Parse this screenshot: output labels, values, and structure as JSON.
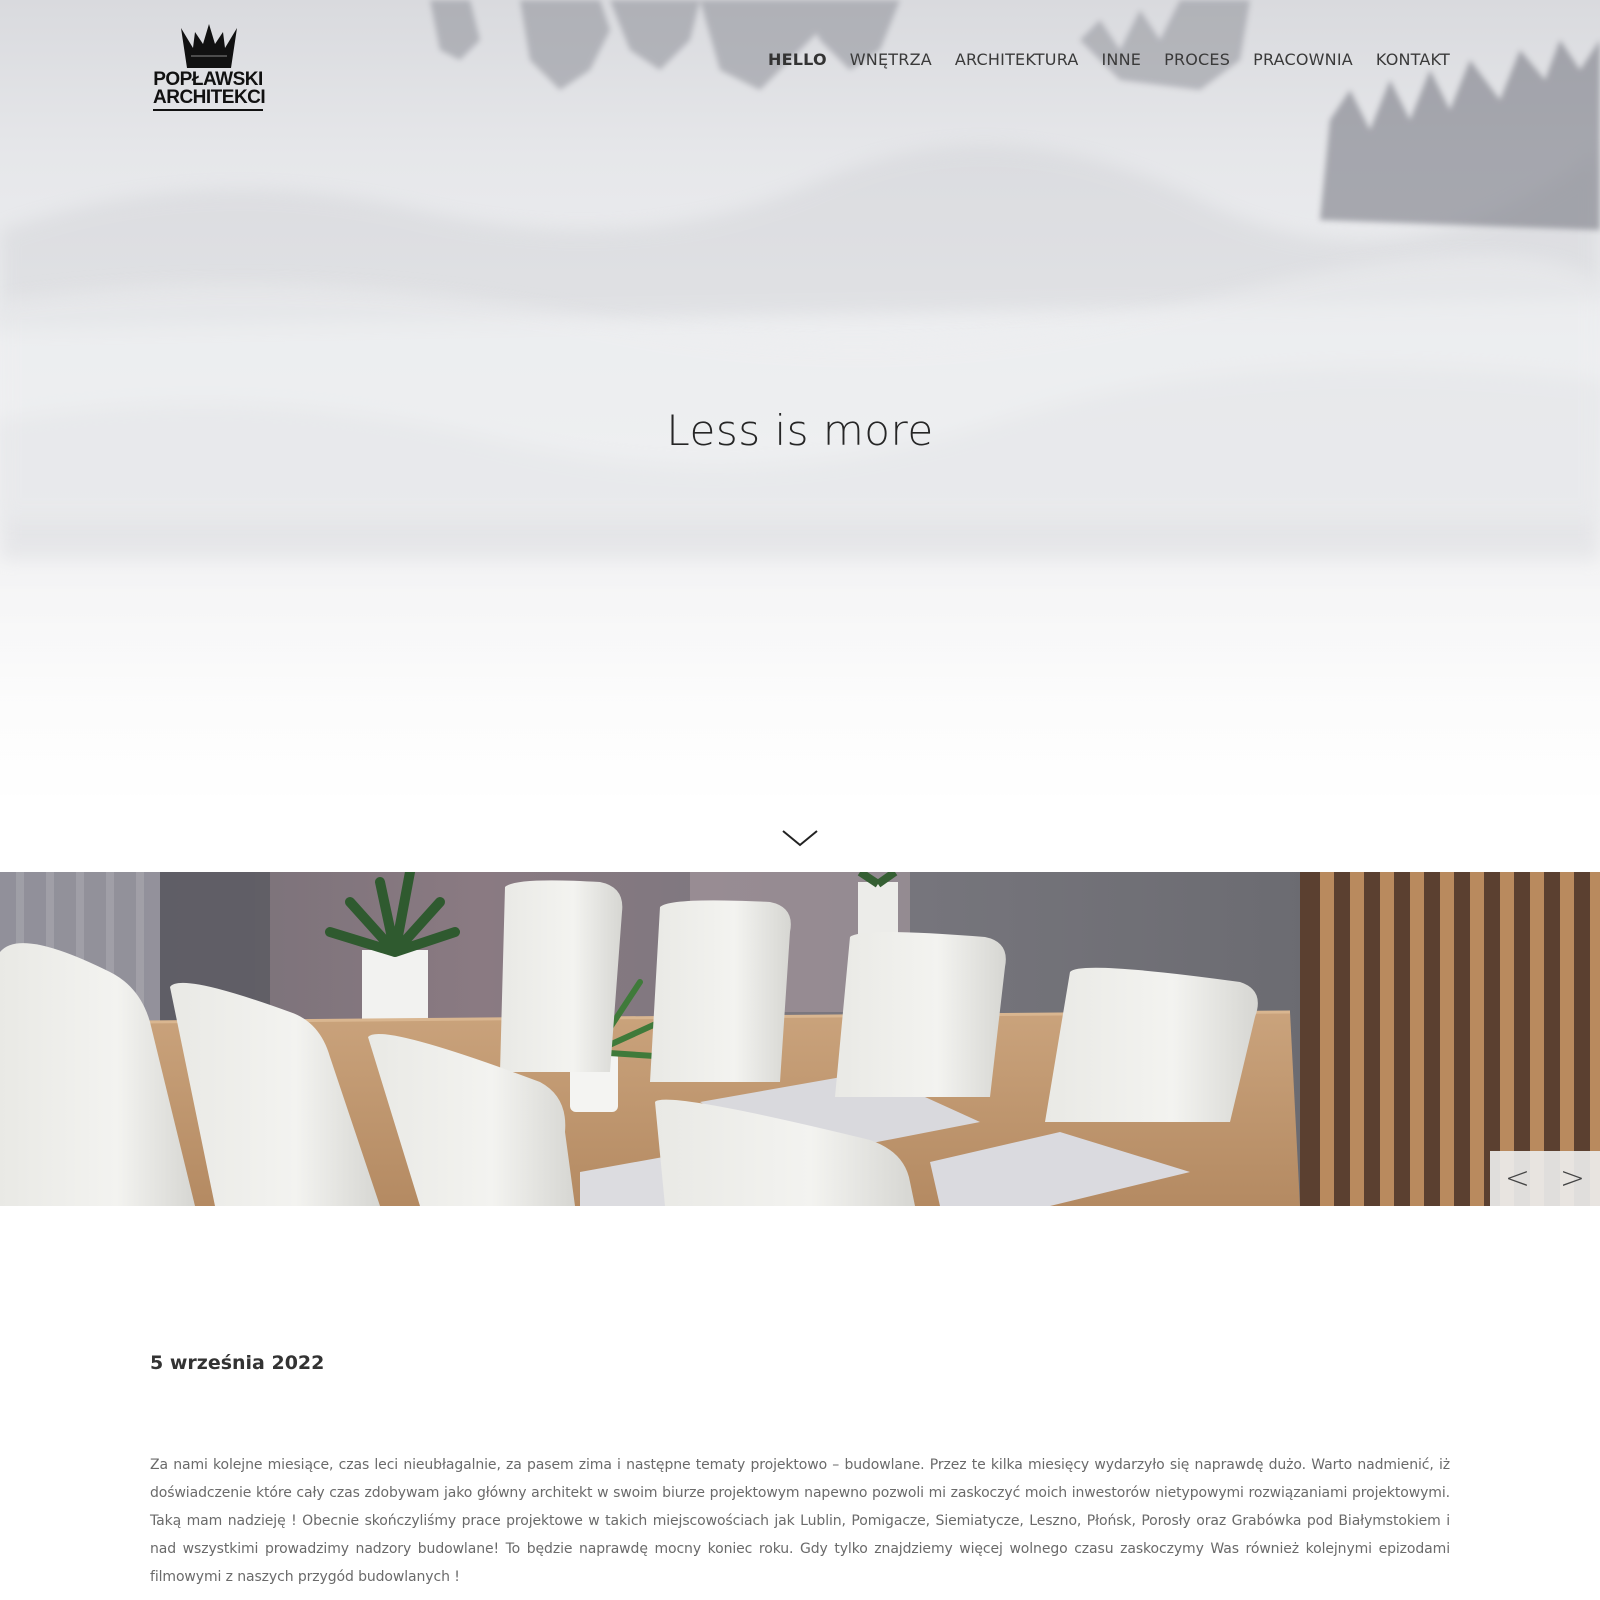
{
  "brand": {
    "line1": "POPŁAWSKI",
    "line2": "ARCHITEKCI"
  },
  "nav": [
    {
      "label": "HELLO",
      "active": true
    },
    {
      "label": "WNĘTRZA"
    },
    {
      "label": "ARCHITEKTURA"
    },
    {
      "label": "INNE"
    },
    {
      "label": "PROCES"
    },
    {
      "label": "PRACOWNIA"
    },
    {
      "label": "KONTAKT"
    }
  ],
  "hero": {
    "tagline": "Less is more",
    "scroll_icon": "chevron-down-icon"
  },
  "slider": {
    "prev_label": "<",
    "next_label": ">"
  },
  "post": {
    "date": "5 września 2022",
    "body": "Za nami kolejne miesiące, czas leci nieubłagalnie, za pasem zima i następne tematy projektowo – budowlane. Przez te kilka miesięcy wydarzyło się naprawdę dużo. Warto nadmienić, iż doświadczenie które cały czas zdobywam jako główny architekt w swoim biurze projektowym napewno pozwoli mi zaskoczyć moich inwestorów nietypowymi rozwiązaniami projektowymi. Taką mam nadzieję ! Obecnie skończyliśmy prace projektowe w takich miejscowościach jak Lublin, Pomigacze, Siemiatycze, Leszno, Płońsk, Porosły oraz Grabówka pod Białymstokiem i nad wszystkimi prowadzimy nadzory budowlane! To będzie naprawdę mocny koniec roku. Gdy tylko znajdziemy więcej wolnego czasu zaskoczymy Was również kolejnymi epizodami filmowymi z naszych przygód budowlanych !"
  },
  "colors": {
    "text_dark": "#333333",
    "text_body": "#6a6a6a",
    "accent_wood": "#c59a6b"
  }
}
